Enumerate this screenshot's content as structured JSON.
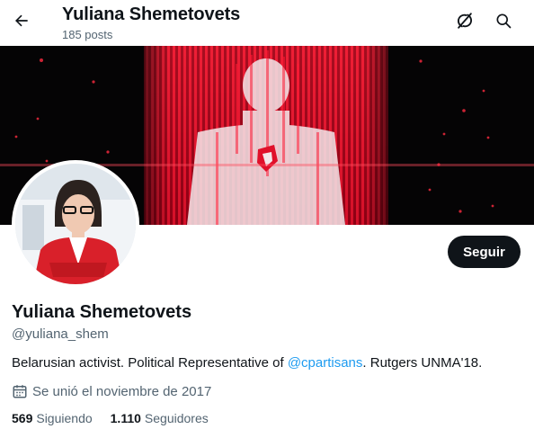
{
  "header": {
    "title": "Yuliana Shemetovets",
    "subtitle": "185 posts"
  },
  "profile": {
    "display_name": "Yuliana Shemetovets",
    "handle": "@yuliana_shem",
    "bio": {
      "before": "Belarusian activist. Political Representative of ",
      "mention": "@cpartisans",
      "after": ". Rutgers UNMA'18."
    },
    "joined": "Se unió el noviembre de 2017",
    "following": {
      "count": "569",
      "label": "Siguiendo"
    },
    "followers": {
      "count": "1.110",
      "label": "Seguidores"
    }
  },
  "actions": {
    "follow_label": "Seguir"
  },
  "icons": {
    "back": "arrow-left-icon",
    "grok": "grok-icon",
    "search": "search-icon",
    "calendar": "calendar-icon"
  },
  "colors": {
    "text_primary": "#0f1419",
    "text_secondary": "#536471",
    "link": "#1d9bf0",
    "button_bg": "#0f1419",
    "banner_red": "#e0102a"
  }
}
